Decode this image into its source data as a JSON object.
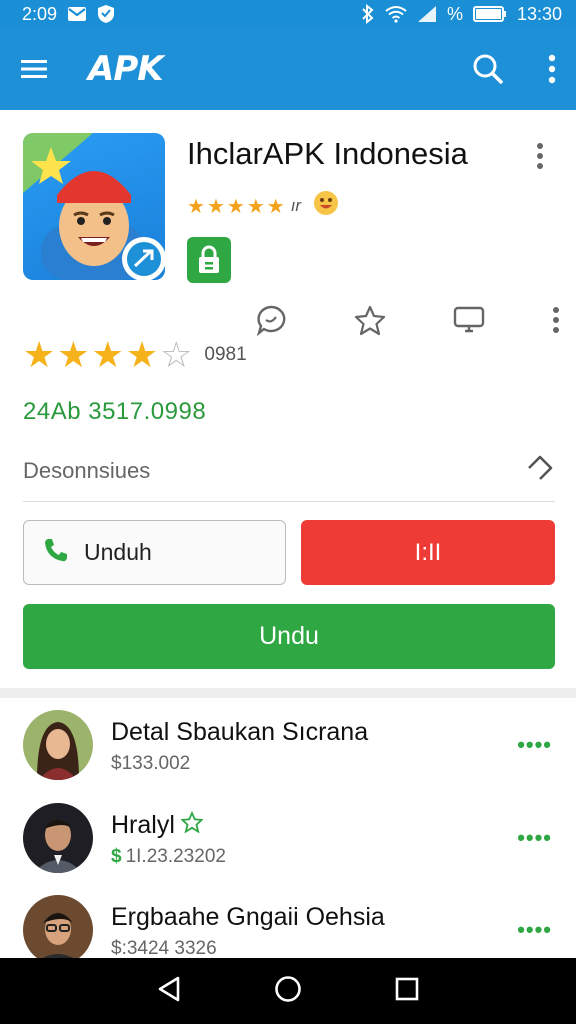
{
  "status_bar": {
    "time_left": "2:09",
    "battery": "%",
    "time_right": "13:30"
  },
  "app_bar": {
    "logo": "APK"
  },
  "app": {
    "title": "IhclarAPK Indonesia",
    "mini_rating_text": "ır",
    "rating_count": "0981",
    "rating_value": 4,
    "stats": "24Ab 3517.0998",
    "description_label": "Desonnsiues"
  },
  "buttons": {
    "outline_label": "Unduh",
    "red_label": "I:II",
    "green_label": "Undu"
  },
  "list": [
    {
      "title": "Detal Sbaukan Sıcrana",
      "subtitle": "$133.002"
    },
    {
      "title": "Hralyl",
      "subtitle": "1I.23.23202"
    },
    {
      "title": "Ergbaahe Gngaii Oehsia",
      "subtitle": "$:3424 3326"
    }
  ],
  "colors": {
    "primary": "#1e90d8",
    "green": "#2fa844",
    "red": "#ee3b36",
    "star": "#f5b21b"
  },
  "icons": {
    "menu": "hamburger-icon",
    "search": "search-icon",
    "more": "more-vert-icon",
    "comment": "comment-icon",
    "favorite": "star-outline-icon",
    "screen": "monitor-icon",
    "share": "share-icon",
    "phone": "phone-icon",
    "lock": "lock-icon"
  }
}
